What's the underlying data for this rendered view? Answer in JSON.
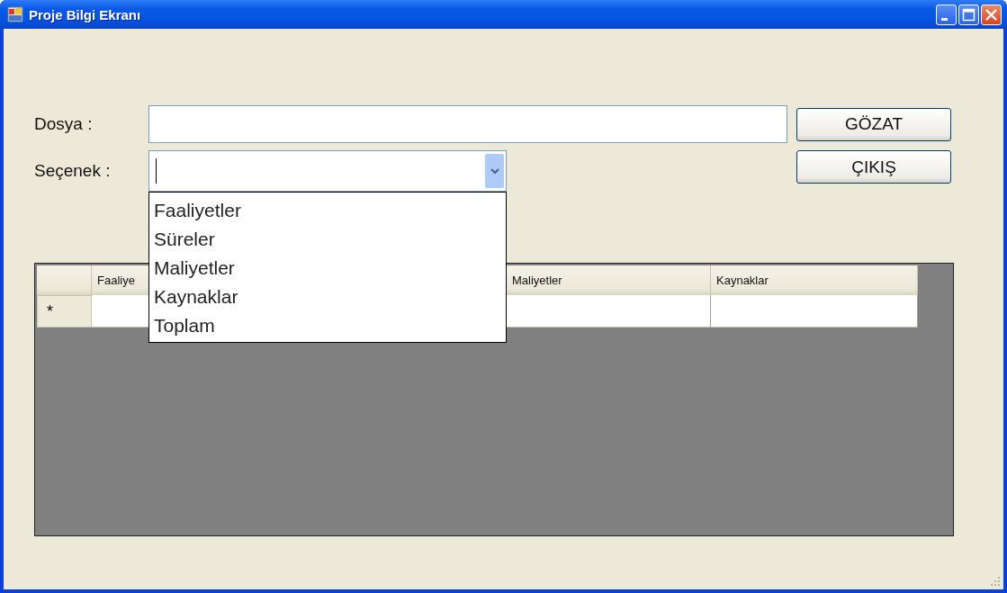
{
  "window": {
    "title": "Proje Bilgi Ekranı"
  },
  "file": {
    "label": "Dosya :"
  },
  "browse_button": "GÖZAT",
  "option": {
    "label": "Seçenek :",
    "expanded": true,
    "items": [
      {
        "label": "Faaliyetler",
        "selected": false
      },
      {
        "label": "Süreler",
        "selected": false
      },
      {
        "label": "Maliyetler",
        "selected": false
      },
      {
        "label": "Kaynaklar",
        "selected": false
      },
      {
        "label": "Toplam",
        "selected": false
      }
    ]
  },
  "exit_button": "ÇIKIŞ",
  "table": {
    "columns": [
      "Faaliye",
      "Maliyetler",
      "Kaynaklar"
    ],
    "new_row_marker": "*"
  }
}
